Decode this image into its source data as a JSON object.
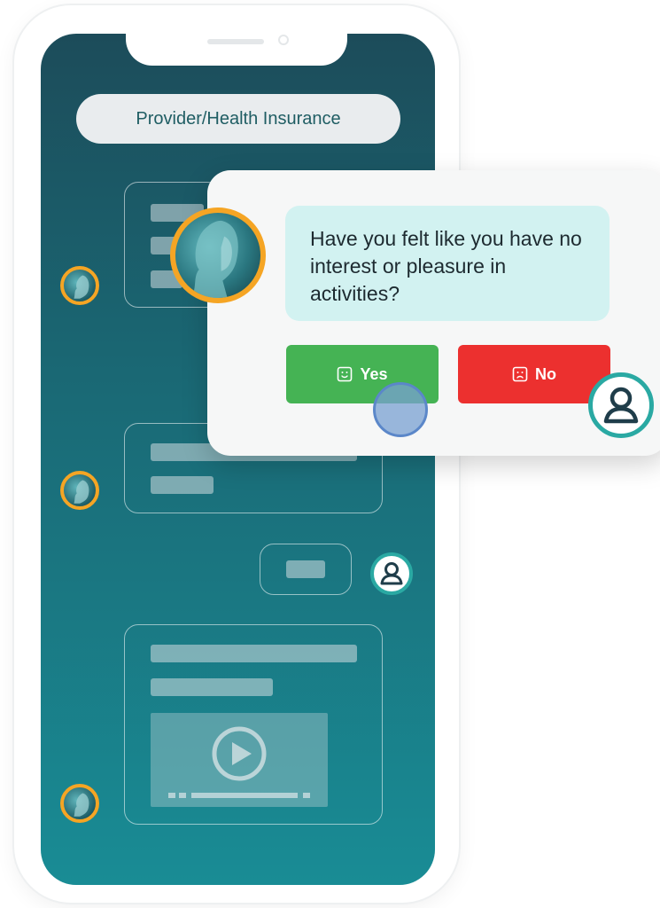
{
  "header": {
    "title": "Provider/Health Insurance"
  },
  "popup": {
    "question": "Have you felt like you have no interest or pleasure in activities?",
    "yes_label": "Yes",
    "no_label": "No"
  },
  "colors": {
    "accent_teal": "#2aa9a3",
    "avatar_ring": "#f5a524",
    "yes_green": "#45b354",
    "no_red": "#ec302f",
    "bubble_bg": "#d2f2f1"
  },
  "icons": {
    "yes": "smile-icon",
    "no": "frown-icon",
    "play": "play-icon",
    "user": "user-icon"
  }
}
